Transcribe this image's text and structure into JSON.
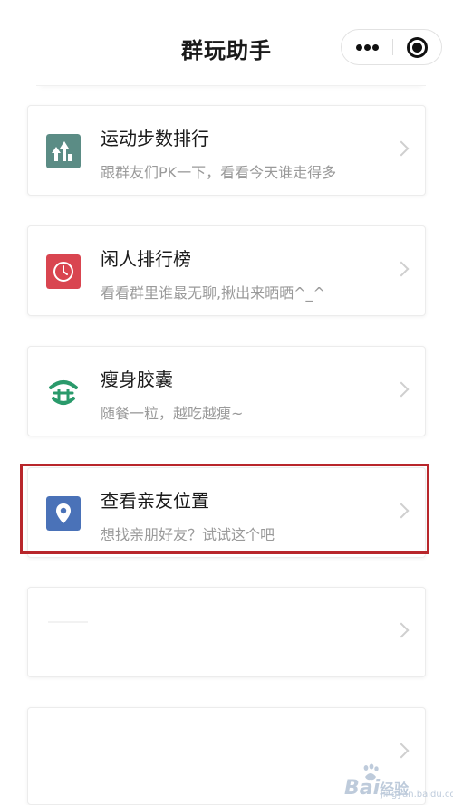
{
  "header": {
    "title": "群玩助手"
  },
  "cards": [
    {
      "title": "运动步数排行",
      "subtitle": "跟群友们PK一下，看看今天谁走得多",
      "icon": "trending-up-icon",
      "icon_color": "#5b8c85"
    },
    {
      "title": "闲人排行榜",
      "subtitle": "看看群里谁最无聊,揪出来晒晒^_^",
      "icon": "clock-icon",
      "icon_color": "#d94550"
    },
    {
      "title": "瘦身胶囊",
      "subtitle": "随餐一粒，越吃越瘦~",
      "icon": "capsule-logo-icon",
      "icon_color": "#2a9a6b"
    },
    {
      "title": "查看亲友位置",
      "subtitle": "想找亲朋好友？试试这个吧",
      "icon": "location-pin-icon",
      "icon_color": "#4a72b8"
    }
  ],
  "highlight_color": "#b8262b",
  "watermark": {
    "brand": "Bai",
    "brand_suffix": "经验",
    "sub": "jingyan.baidu.com"
  }
}
